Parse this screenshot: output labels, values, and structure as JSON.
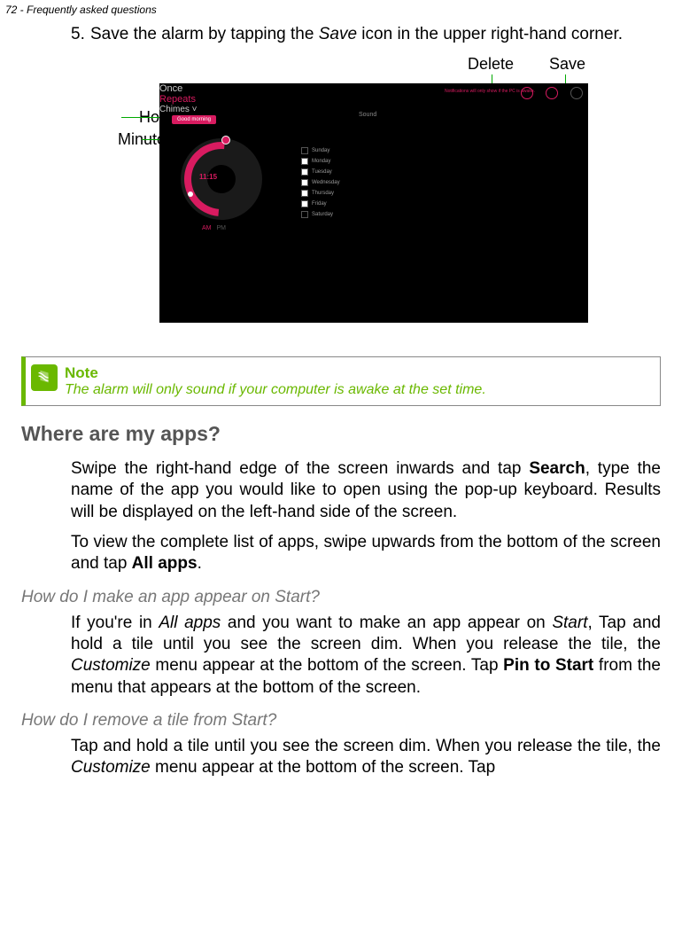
{
  "header": "72 - Frequently asked questions",
  "step": {
    "num": "5.",
    "parts": [
      "Save the alarm by tapping the ",
      "Save",
      " icon in the upper right-hand corner."
    ]
  },
  "callouts": {
    "delete": "Delete",
    "save": "Save",
    "hour": "Hour",
    "minutes": "Minutes"
  },
  "alarm_ui": {
    "tag": "Good morning",
    "time": "11:15",
    "am": "AM",
    "pm": "PM",
    "once": "Once",
    "repeats": "Repeats",
    "sound_hdr": "Sound",
    "chimes": "Chimes ˅",
    "notif": "Notifications will only show if the PC is awake.",
    "days": [
      "Sunday",
      "Monday",
      "Tuesday",
      "Wednesday",
      "Thursday",
      "Friday",
      "Saturday"
    ]
  },
  "note": {
    "title": "Note",
    "text": "The alarm will only sound if your computer is awake at the set time."
  },
  "h2": "Where are my apps?",
  "p1": [
    "Swipe the right-hand edge of the screen inwards and tap ",
    "Search",
    ", type the name of the app you would like to open using the pop-up keyboard. Results will be displayed on the left-hand side of the screen."
  ],
  "p2": [
    "To view the complete list of apps, swipe upwards from the bottom of the screen and tap ",
    "All apps",
    "."
  ],
  "h3a": "How do I make an app appear on Start?",
  "p3": [
    "If you're in ",
    "All apps",
    " and you want to make an app appear on ",
    "Start",
    ", Tap and hold a tile until you see the screen dim. When you release the tile, the ",
    "Customize",
    " menu appear at the bottom of the screen. Tap ",
    "Pin to Start",
    " from the menu that appears at the bottom of the screen."
  ],
  "h3b": "How do I remove a tile from Start?",
  "p4": [
    "Tap and hold a tile until you see the screen dim. When you release the tile, the ",
    "Customize",
    " menu appear at the bottom of the screen. Tap"
  ]
}
